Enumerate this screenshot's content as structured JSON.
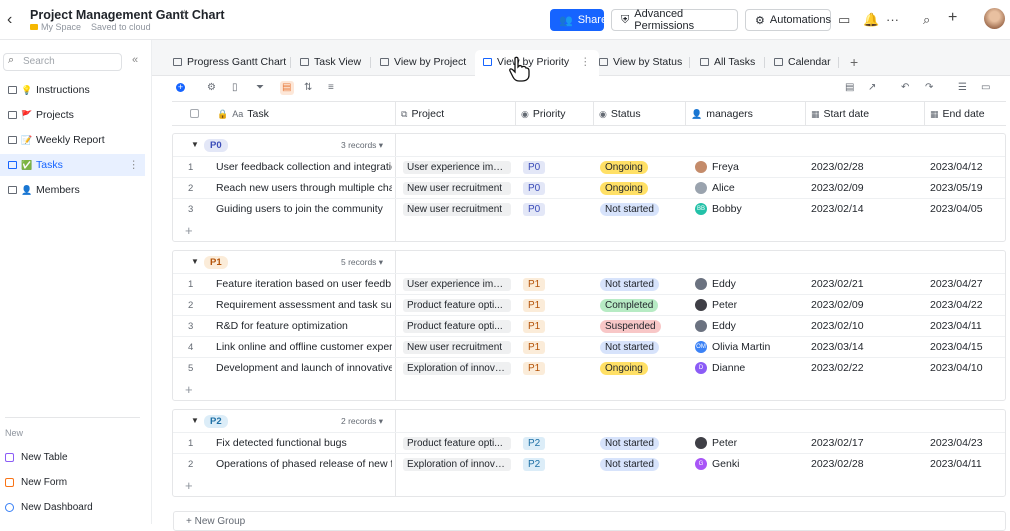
{
  "header": {
    "back_icon": "chevron-left-icon",
    "title": "Project Management Gantt Chart",
    "breadcrumb": "My Space",
    "save_status": "Saved to cloud",
    "share_label": "Share",
    "advanced_permissions_label": "Advanced Permissions",
    "automations_label": "Automations"
  },
  "sidebar": {
    "search_placeholder": "Search",
    "items": [
      {
        "label": "Instructions",
        "emoji": "💡"
      },
      {
        "label": "Projects",
        "emoji": "🚩"
      },
      {
        "label": "Weekly Report",
        "emoji": "📝"
      },
      {
        "label": "Tasks",
        "emoji": "✅"
      },
      {
        "label": "Members",
        "emoji": "👤"
      }
    ],
    "new_label": "New",
    "new_items": [
      {
        "label": "New Table",
        "color": "#8b5cf6"
      },
      {
        "label": "New Form",
        "color": "#f97316"
      },
      {
        "label": "New Dashboard",
        "color": "#3b82f6"
      }
    ]
  },
  "tabs": [
    {
      "label": "Progress Gantt Chart"
    },
    {
      "label": "Task View"
    },
    {
      "label": "View by Project"
    },
    {
      "label": "View by Priority"
    },
    {
      "label": "View by Status"
    },
    {
      "label": "All Tasks"
    },
    {
      "label": "Calendar"
    }
  ],
  "columns": {
    "task": "Task",
    "project": "Project",
    "priority": "Priority",
    "status": "Status",
    "managers": "managers",
    "start": "Start date",
    "end": "End date"
  },
  "colors": {
    "accent": "#1664ff",
    "p0_tag": "#e3e7f7",
    "p1_tag": "#fbecd9",
    "p2_tag": "#dcedf8",
    "ongoing": "#ffe066",
    "not_started": "#d7e3fb",
    "completed": "#b7ebc4",
    "suspended": "#f8c7c7"
  },
  "groups": [
    {
      "tag": "P0",
      "count": "3 records",
      "rows": [
        {
          "num": "1",
          "task": "User feedback collection and integration",
          "project": "User experience imp...",
          "priority": "P0",
          "status": "Ongoing",
          "manager": "Freya",
          "avatar": "#c48b6a",
          "initials": "",
          "start": "2023/02/28",
          "end": "2023/04/12"
        },
        {
          "num": "2",
          "task": "Reach new users through multiple cha...",
          "project": "New user recruitment",
          "priority": "P0",
          "status": "Ongoing",
          "manager": "Alice",
          "avatar": "#9aa3ae",
          "initials": "",
          "start": "2023/02/09",
          "end": "2023/05/19"
        },
        {
          "num": "3",
          "task": "Guiding users to join the community",
          "project": "New user recruitment",
          "priority": "P0",
          "status": "Not started",
          "manager": "Bobby",
          "avatar": "#23c1a8",
          "initials": "BB",
          "start": "2023/02/14",
          "end": "2023/04/05"
        }
      ]
    },
    {
      "tag": "P1",
      "count": "5 records",
      "rows": [
        {
          "num": "1",
          "task": "Feature iteration based on user feedb...",
          "project": "User experience imp...",
          "priority": "P1",
          "status": "Not started",
          "manager": "Eddy",
          "avatar": "#6b7280",
          "initials": "",
          "start": "2023/02/21",
          "end": "2023/04/27"
        },
        {
          "num": "2",
          "task": "Requirement assessment and task sub...",
          "project": "Product feature opti...",
          "priority": "P1",
          "status": "Completed",
          "manager": "Peter",
          "avatar": "#3f3f46",
          "initials": "",
          "start": "2023/02/09",
          "end": "2023/04/22"
        },
        {
          "num": "3",
          "task": "R&D for feature optimization",
          "project": "Product feature opti...",
          "priority": "P1",
          "status": "Suspended",
          "manager": "Eddy",
          "avatar": "#6b7280",
          "initials": "",
          "start": "2023/02/10",
          "end": "2023/04/11"
        },
        {
          "num": "4",
          "task": "Link online and offline customer experi...",
          "project": "New user recruitment",
          "priority": "P1",
          "status": "Not started",
          "manager": "Olivia Martin",
          "avatar": "#3b82f6",
          "initials": "OM",
          "start": "2023/03/14",
          "end": "2023/04/15"
        },
        {
          "num": "5",
          "task": "Development and launch of innovative ...",
          "project": "Exploration of innova...",
          "priority": "P1",
          "status": "Ongoing",
          "manager": "Dianne",
          "avatar": "#8b5cf6",
          "initials": "D",
          "start": "2023/02/22",
          "end": "2023/04/10"
        }
      ]
    },
    {
      "tag": "P2",
      "count": "2 records",
      "rows": [
        {
          "num": "1",
          "task": "Fix detected functional bugs",
          "project": "Product feature opti...",
          "priority": "P2",
          "status": "Not started",
          "manager": "Peter",
          "avatar": "#3f3f46",
          "initials": "",
          "start": "2023/02/17",
          "end": "2023/04/23"
        },
        {
          "num": "2",
          "task": "Operations of phased release of new f...",
          "project": "Exploration of innova...",
          "priority": "P2",
          "status": "Not started",
          "manager": "Genki",
          "avatar": "#a855f7",
          "initials": "G",
          "start": "2023/02/28",
          "end": "2023/04/11"
        }
      ]
    }
  ],
  "new_group_label": "+ New Group"
}
